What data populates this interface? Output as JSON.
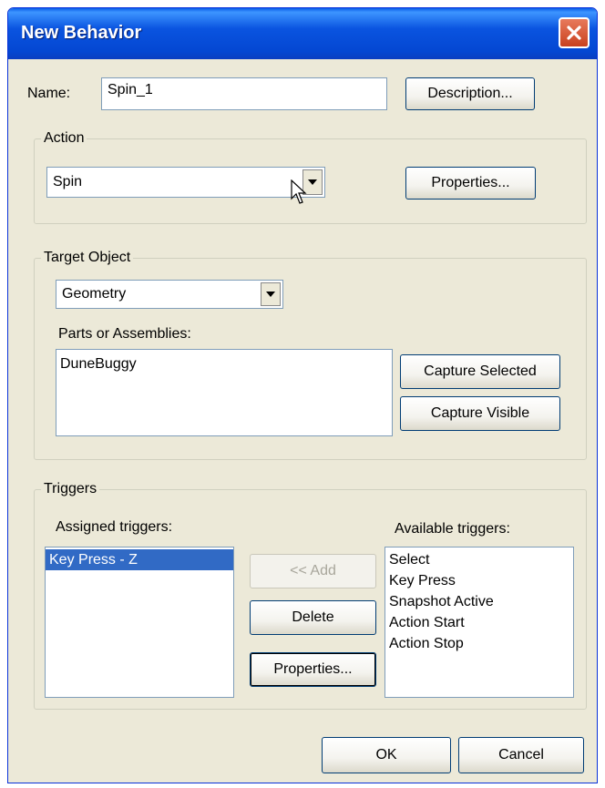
{
  "window": {
    "title": "New Behavior"
  },
  "name": {
    "label": "Name:",
    "value": "Spin_1",
    "description_button": "Description..."
  },
  "action": {
    "group_label": "Action",
    "selected": "Spin",
    "properties_button": "Properties..."
  },
  "target": {
    "group_label": "Target Object",
    "type_selected": "Geometry",
    "parts_label": "Parts or Assemblies:",
    "parts": [
      "DuneBuggy"
    ],
    "capture_selected_button": "Capture Selected",
    "capture_visible_button": "Capture Visible"
  },
  "triggers": {
    "group_label": "Triggers",
    "assigned_label": "Assigned triggers:",
    "assigned": [
      "Key Press - Z"
    ],
    "available_label": "Available triggers:",
    "available": [
      "Select",
      "Key Press",
      "Snapshot Active",
      "Action Start",
      "Action Stop"
    ],
    "add_button": "<< Add",
    "delete_button": "Delete",
    "properties_button": "Properties..."
  },
  "footer": {
    "ok_button": "OK",
    "cancel_button": "Cancel"
  }
}
